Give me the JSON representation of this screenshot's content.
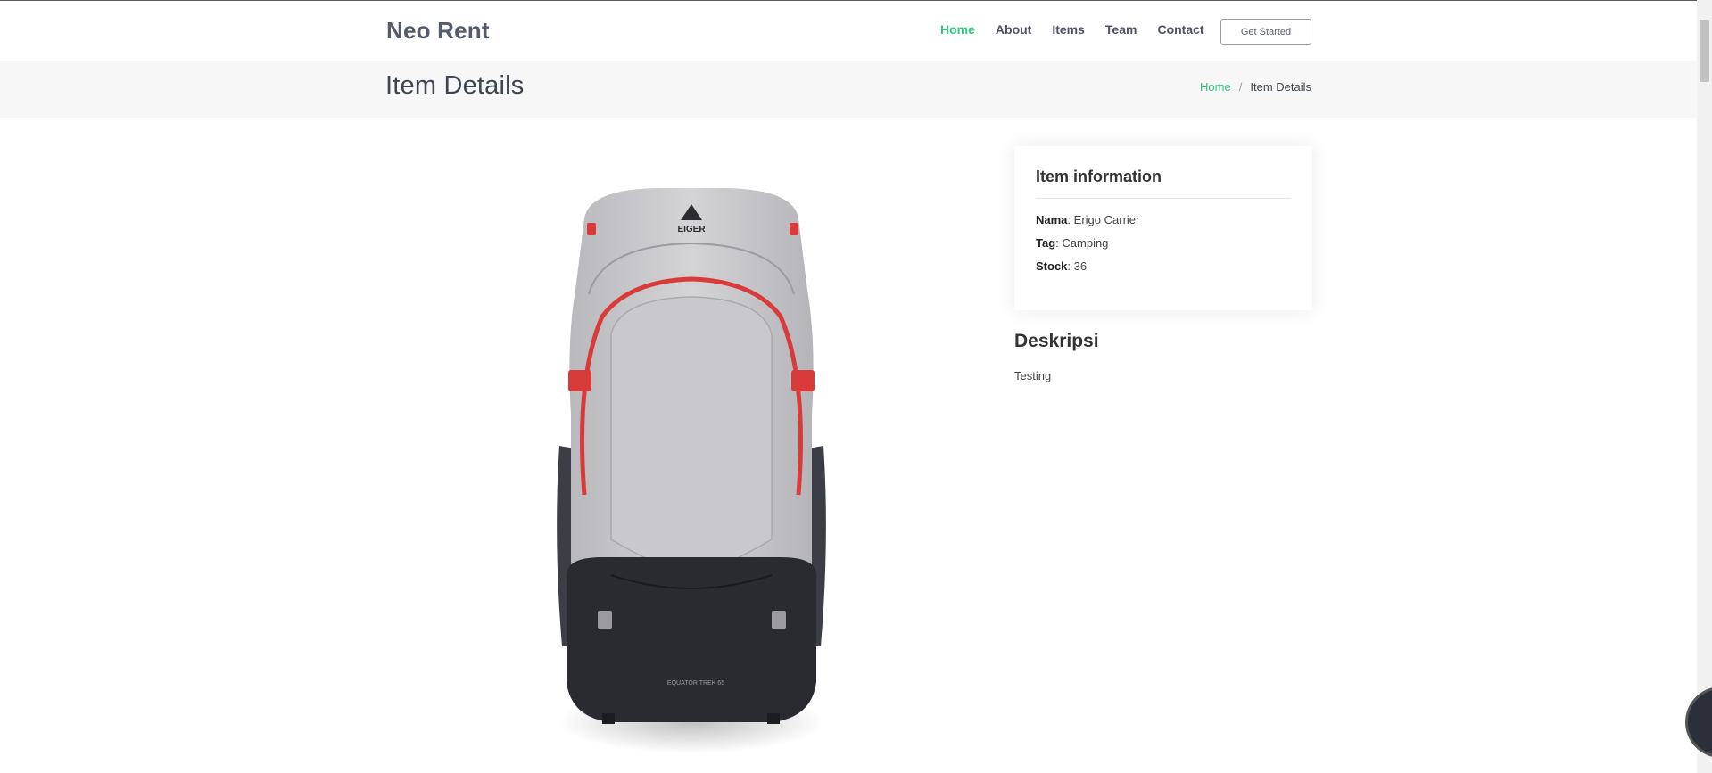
{
  "header": {
    "logo": "Neo Rent",
    "nav": [
      {
        "label": "Home",
        "active": true
      },
      {
        "label": "About",
        "active": false
      },
      {
        "label": "Items",
        "active": false
      },
      {
        "label": "Team",
        "active": false
      },
      {
        "label": "Contact",
        "active": false
      }
    ],
    "cta_label": "Get Started"
  },
  "breadcrumbs": {
    "title": "Item Details",
    "home": "Home",
    "separator": "/",
    "current": "Item Details"
  },
  "product": {
    "image_brand": "EIGER",
    "image_model": "EQUATOR TREK 65"
  },
  "info": {
    "title": "Item information",
    "rows": [
      {
        "label": "Nama",
        "value": "Erigo Carrier"
      },
      {
        "label": "Tag",
        "value": "Camping"
      },
      {
        "label": "Stock",
        "value": "36"
      }
    ]
  },
  "description": {
    "title": "Deskripsi",
    "text": "Testing"
  },
  "colors": {
    "accent": "#2fc57a",
    "nav_text": "#4b5266",
    "breadcrumb_bg": "#f7f7f7"
  }
}
